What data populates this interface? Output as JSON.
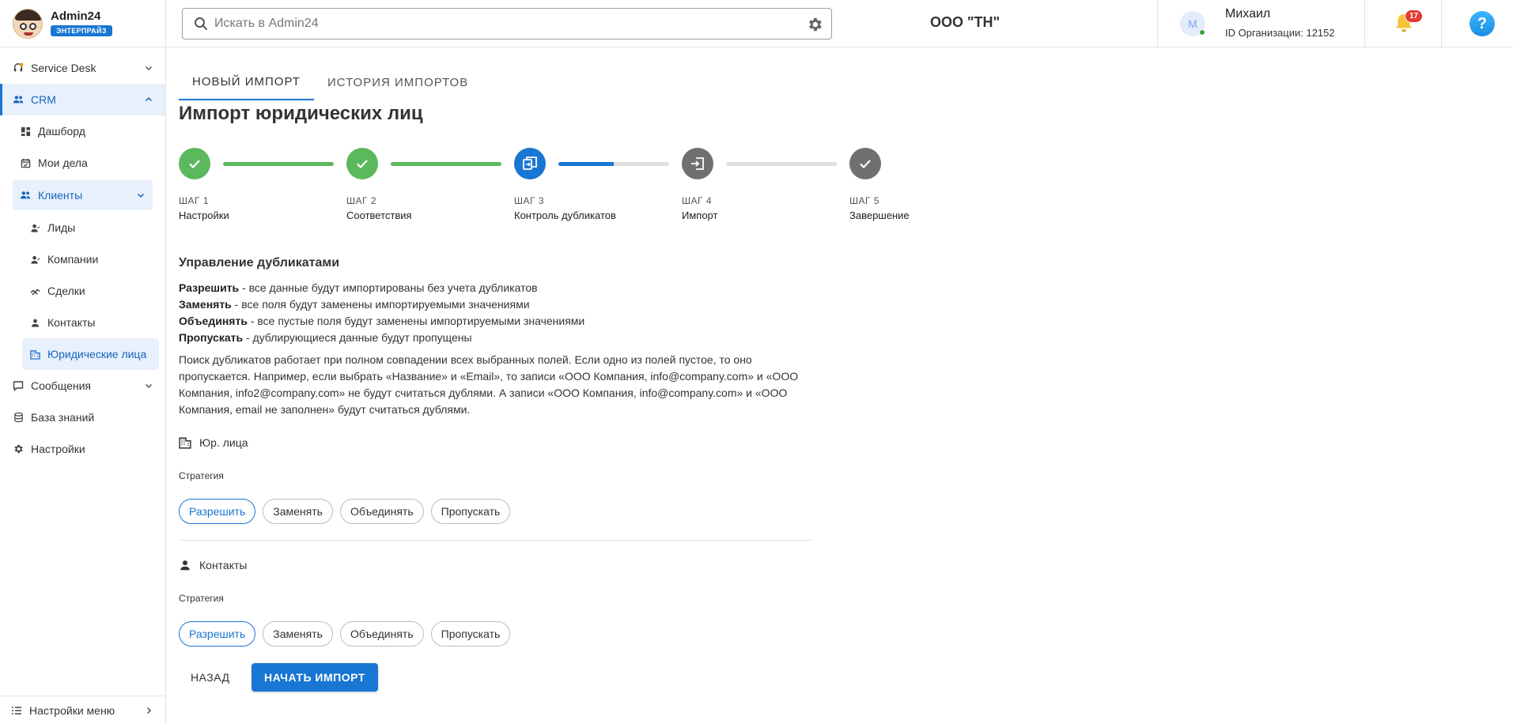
{
  "brand": {
    "name": "Admin24",
    "badge": "ЭНТЕРПРАЙЗ"
  },
  "sidebar": {
    "items": [
      {
        "label": "Service Desk",
        "icon": "headset-icon"
      },
      {
        "label": "CRM",
        "icon": "people-icon"
      },
      {
        "label": "Дашборд",
        "icon": "dashboard-icon"
      },
      {
        "label": "Мои дела",
        "icon": "calendar-check-icon"
      },
      {
        "label": "Клиенты",
        "icon": "people-icon"
      },
      {
        "label": "Лиды",
        "icon": "person-icon"
      },
      {
        "label": "Компании",
        "icon": "person-icon"
      },
      {
        "label": "Сделки",
        "icon": "handshake-icon"
      },
      {
        "label": "Контакты",
        "icon": "person-icon"
      },
      {
        "label": "Юридические лица",
        "icon": "building-icon"
      },
      {
        "label": "Сообщения",
        "icon": "chat-icon"
      },
      {
        "label": "База знаний",
        "icon": "database-icon"
      },
      {
        "label": "Настройки",
        "icon": "gear-icon"
      }
    ],
    "footer_label": "Настройки меню"
  },
  "header": {
    "search_placeholder": "Искать в Admin24",
    "org_title": "ООО \"ТН\"",
    "avatar_letter": "М",
    "user_name": "Михаил",
    "org_id": "ID Организации: 12152",
    "notifications_count": "17",
    "help_glyph": "?"
  },
  "tabs": [
    {
      "label": "НОВЫЙ ИМПОРТ",
      "active": true
    },
    {
      "label": "ИСТОРИЯ ИМПОРТОВ",
      "active": false
    }
  ],
  "page_title": "Импорт юридических лиц",
  "steps": [
    {
      "num": "ШАГ 1",
      "label": "Настройки",
      "status": "done"
    },
    {
      "num": "ШАГ 2",
      "label": "Соответствия",
      "status": "done"
    },
    {
      "num": "ШАГ 3",
      "label": "Контроль дубликатов",
      "status": "current",
      "progress": 0.5
    },
    {
      "num": "ШАГ 4",
      "label": "Импорт",
      "status": "pending"
    },
    {
      "num": "ШАГ 5",
      "label": "Завершение",
      "status": "pending"
    }
  ],
  "duplicates": {
    "title": "Управление дубликатами",
    "rules": [
      {
        "term": "Разрешить",
        "text": " - все данные будут импортированы без учета дубликатов"
      },
      {
        "term": "Заменять",
        "text": " - все поля будут заменены импортируемыми значениями"
      },
      {
        "term": "Объединять",
        "text": " - все пустые поля будут заменены импортируемыми значениями"
      },
      {
        "term": "Пропускать",
        "text": " - дублирующиеся данные будут пропущены"
      }
    ],
    "description": "Поиск дубликатов работает при полном совпадении всех выбранных полей. Если одно из полей пустое, то оно пропускается. Например, если выбрать «Название» и «Email», то записи «ООО Компания, info@company.com» и «ООО Компания, info2@company.com» не будут считаться дублями. А записи «ООО Компания, info@company.com» и «ООО Компания, email не заполнен» будут считаться дублями."
  },
  "groups": [
    {
      "title": "Юр. лица",
      "strategy_label": "Стратегия",
      "options": [
        "Разрешить",
        "Заменять",
        "Объединять",
        "Пропускать"
      ],
      "selected": "Разрешить"
    },
    {
      "title": "Контакты",
      "strategy_label": "Стратегия",
      "options": [
        "Разрешить",
        "Заменять",
        "Объединять",
        "Пропускать"
      ],
      "selected": "Разрешить"
    }
  ],
  "actions": {
    "back": "НАЗАД",
    "start": "НАЧАТЬ ИМПОРТ"
  },
  "colors": {
    "primary": "#1976d2",
    "done": "#5cb85c",
    "pending": "#707070"
  }
}
